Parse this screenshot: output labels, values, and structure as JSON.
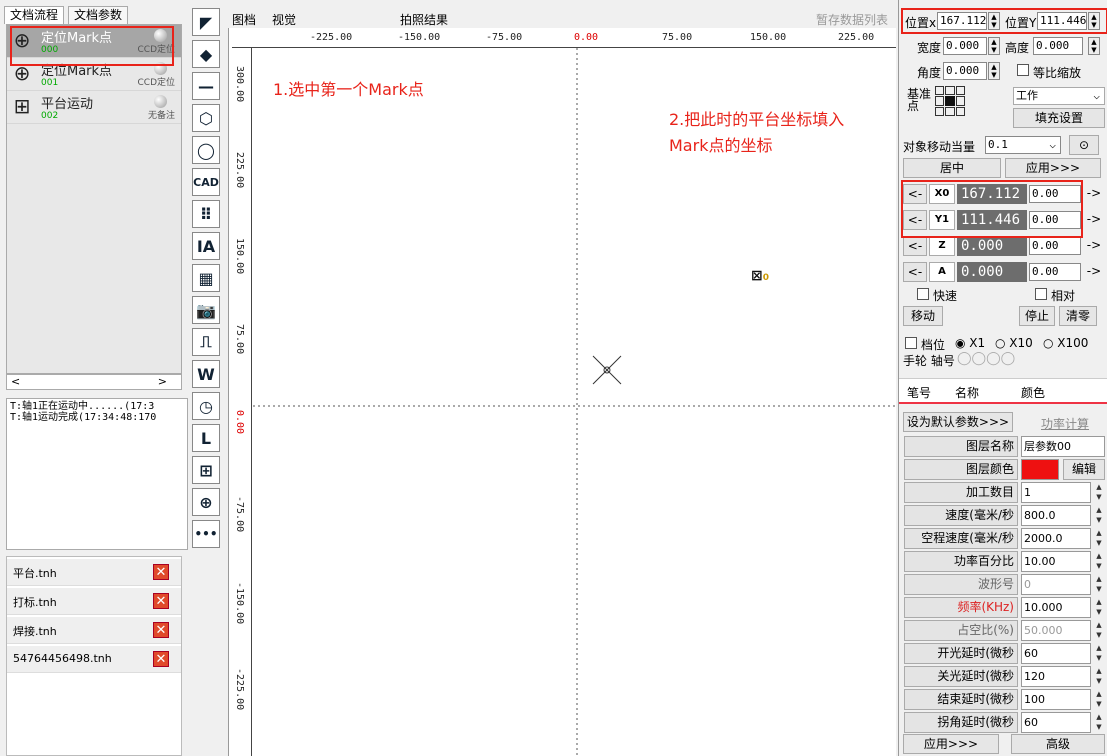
{
  "left": {
    "tabs": [
      "文档流程",
      "文档参数"
    ],
    "flow_items": [
      {
        "name": "定位Mark点",
        "num": "000",
        "tag": "CCD定位"
      },
      {
        "name": "定位Mark点",
        "num": "001",
        "tag": "CCD定位"
      },
      {
        "name": "平台运动",
        "num": "002",
        "tag": "无备注"
      }
    ],
    "log_lines": [
      "T:轴1正在运动中......(17:3",
      "T:轴1运动完成(17:34:48:170"
    ],
    "files": [
      "平台.tnh",
      "打标.tnh",
      "焊接.tnh",
      "54764456498.tnh"
    ],
    "scroll_left": "<",
    "scroll_right": ">"
  },
  "tools": [
    "arrow-icon",
    "point-icon",
    "line-icon",
    "hexagon-icon",
    "circle-icon",
    "cad-icon",
    "dot-grid-icon",
    "text-icon",
    "qr-icon",
    "camera-icon",
    "pulse-icon",
    "waveform-icon",
    "clock-icon",
    "corner-icon",
    "grid-icon",
    "mark-icon",
    "more-icon"
  ],
  "tool_glyphs": [
    "◤",
    "◆",
    "—",
    "⬡",
    "◯",
    "CAD",
    "⠿",
    "IA",
    "▦",
    "📷",
    "⎍",
    "W",
    "◷",
    "L",
    "⊞",
    "⊕",
    "•••"
  ],
  "canvas": {
    "tabs": [
      "图档",
      "视觉",
      "拍照结果",
      "暂存数据列表"
    ],
    "ruler_top": [
      "-225.00",
      "-150.00",
      "-75.00",
      "0.00",
      "75.00",
      "150.00",
      "225.00"
    ],
    "ruler_left": [
      "300.00",
      "225.00",
      "150.00",
      "75.00",
      "0.00",
      "-75.00",
      "-150.00",
      "-225.00"
    ],
    "note1": "1.选中第一个Mark点",
    "note2_line1": "2.把此时的平台坐标填入",
    "note2_line2": "Mark点的坐标",
    "mark_label": "0"
  },
  "right": {
    "pos_x_label": "位置x",
    "pos_x": "167.112",
    "pos_y_label": "位置Y",
    "pos_y": "111.446",
    "width_label": "宽度",
    "width": "0.000",
    "height_label": "高度",
    "height": "0.000",
    "angle_label": "角度",
    "angle": "0.000",
    "proportional": "等比缩放",
    "base_label": "基准点",
    "work": "工作",
    "fill_settings": "填充设置",
    "move_step_label": "对象移动当量",
    "move_step": "0.1",
    "center": "居中",
    "apply": "应用>>>",
    "axes": [
      {
        "name": "X0",
        "value": "167.112",
        "input": "0.00"
      },
      {
        "name": "Y1",
        "value": "111.446",
        "input": "0.00"
      },
      {
        "name": "Z",
        "value": "0.000",
        "input": "0.00"
      },
      {
        "name": "A",
        "value": "0.000",
        "input": "0.00"
      }
    ],
    "left_arrow": "<-",
    "right_arrow": "->",
    "fast": "快速",
    "relative": "相对",
    "move": "移动",
    "stop": "停止",
    "clear": "清零",
    "gear_label": "档位",
    "gears": [
      "X1",
      "X10",
      "X100"
    ],
    "handwheel": "手轮 轴号",
    "table_headers": [
      "笔号",
      "名称",
      "颜色"
    ],
    "set_default": "设为默认参数>>>",
    "power_calc": "功率计算",
    "params": [
      {
        "label": "图层名称",
        "value": "层参数00"
      },
      {
        "label": "图层颜色",
        "value": ""
      },
      {
        "label": "加工数目",
        "value": "1"
      },
      {
        "label": "速度(毫米/秒",
        "value": "800.0"
      },
      {
        "label": "空程速度(毫米/秒",
        "value": "2000.0"
      },
      {
        "label": "功率百分比",
        "value": "10.00"
      },
      {
        "label": "波形号",
        "value": "0"
      },
      {
        "label": "频率(KHz)",
        "value": "10.000"
      },
      {
        "label": "占空比(%)",
        "value": "50.000"
      },
      {
        "label": "开光延时(微秒",
        "value": "60"
      },
      {
        "label": "关光延时(微秒",
        "value": "120"
      },
      {
        "label": "结束延时(微秒",
        "value": "100"
      },
      {
        "label": "拐角延时(微秒",
        "value": "60"
      }
    ],
    "edit": "编辑",
    "apply2": "应用>>>",
    "advanced": "高级",
    "color_red": "#ee1111"
  }
}
